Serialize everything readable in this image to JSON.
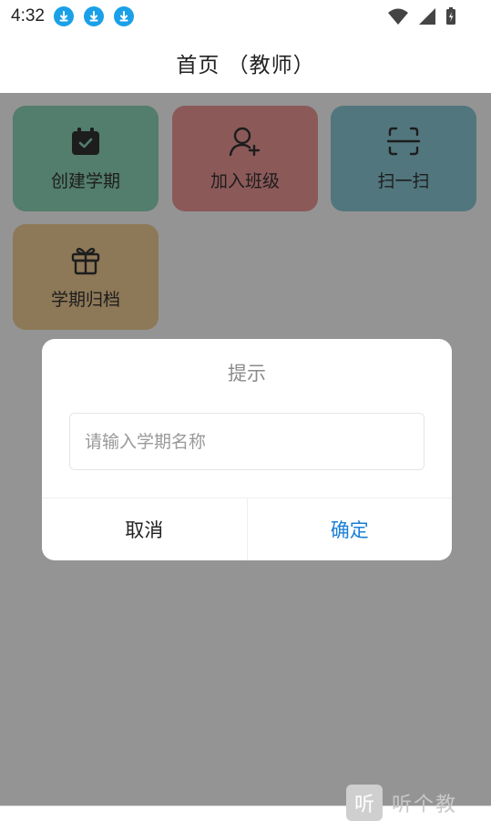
{
  "status_bar": {
    "time": "4:32",
    "download_icons": [
      "download-icon",
      "download-icon",
      "download-icon"
    ]
  },
  "header": {
    "title": "首页 （教师）"
  },
  "tiles": [
    {
      "label": "创建学期",
      "icon": "calendar-check-icon",
      "color": "#8fd8ba"
    },
    {
      "label": "加入班级",
      "icon": "add-user-icon",
      "color": "#f19a9a"
    },
    {
      "label": "扫一扫",
      "icon": "scan-icon",
      "color": "#8ccbd8"
    },
    {
      "label": "学期归档",
      "icon": "gift-icon",
      "color": "#f3cf97"
    }
  ],
  "dialog": {
    "title": "提示",
    "input_placeholder": "请输入学期名称",
    "input_value": "",
    "cancel_label": "取消",
    "confirm_label": "确定"
  },
  "watermark": {
    "glyph": "听",
    "text": "听个教"
  },
  "colors": {
    "accent": "#1a7fd6",
    "overlay": "rgba(0,0,0,0.42)"
  }
}
